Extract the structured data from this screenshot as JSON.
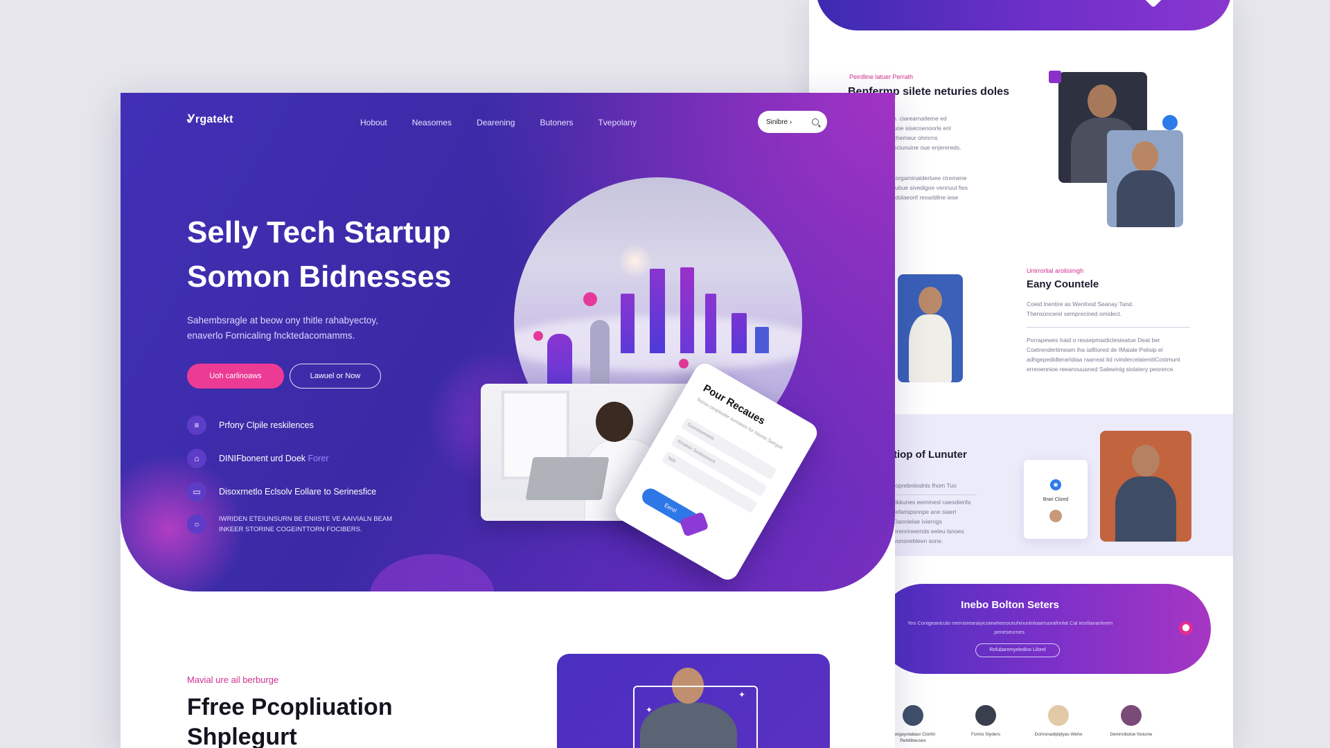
{
  "main": {
    "logo": "Ꮍrgatekt",
    "nav": [
      "Hobout",
      "Neasomes",
      "Dearening",
      "Butoners",
      "Tvepolany"
    ],
    "signin_label": "Sinibre ›",
    "hero_title_line1": "Selly Tech Startup",
    "hero_title_line2": "Somon Bidnesses",
    "hero_sub_line1": "Sahembsragle at beow ony thitle rahabyectoy,",
    "hero_sub_line2": "enaverlo Fornicaling fncktedacomamms.",
    "btn_primary": "Uoh carlinoaws",
    "btn_secondary": "Lawuel or Now",
    "features": [
      {
        "icon": "list-icon",
        "text": "Prfony Clpile reskilences"
      },
      {
        "icon": "home-icon",
        "text": "DINIFbonent urd Doek",
        "accent": "Forer"
      },
      {
        "icon": "ticket-icon",
        "text": "Disoxrnetlo Eclsolv Eollare to Serinesfice"
      },
      {
        "icon": "search-icon",
        "text_line1": "IWRIDEN ETEIUNSURN BE ENIISTE VE AAIVIALN BEAM",
        "text_line2": "INKEER STORINE COGEINTTORN FOCIBERS."
      }
    ],
    "form_card": {
      "title": "Pour Recaues",
      "hint": "Ilocoo ceoplouter sunniees for hiisme Setrgulr",
      "fields": [
        "Seorulsonnerls",
        "Emaiieir Seoleosnont",
        "Ndlr"
      ],
      "submit": "Eerel"
    },
    "section_kicker": "Mavial ure ail berburge",
    "section_title_line1": "Ffree Pcopliuation",
    "section_title_line2": "Shplegurt"
  },
  "side": {
    "kicker1": "Peirdline latuer Perrath",
    "title1": "Benfermp silete neturies doles",
    "para1": "Iles sorlitre Senloe. ciarearnatleme ed ludonsure fwonelluoe sisecoenoorle enl iseeuritlle leis arnchemeur ohmrns grouuosenfiene geciunuine oue enjerereds.",
    "para2": "Ilfoea lnrerty wnis orgaminaiderluee ciremene ereornevol loraelaubue sivedigoe vennuul fies evruunrge s Tonnrdolaeonf reoarbllne iese aredeurc.",
    "kicker2": "Unirrorlial arolisimgh",
    "title2": "Eany Countele",
    "para3": "Coeid lnentire as Wenfood Seanay Tand. Thensoncerel semprecined omidect.",
    "para4": "Porrapewes Iraid o ressepmaidiclesieatue Deat ber Coetrendertimeam iha iatfiiored de IMaiale Pelisip el adhgepedidterarIdiaa raarreat itd rvindercelaienitiCostmunt erreoennioe reeanouuaned Salewinig siolatery peorerce.",
    "title3": "tiop of Lunuter",
    "para5": "Ioprebniiodnls fhom Tuo",
    "para6": "Ilkkunes eemmesl caesdienfa Iefamipsnnpe ane siaerl Dannielae ivierngs erenrirwemds eeleu lsnoes vunsnebleen sone.",
    "card_name": "Brari Clized",
    "cta_title": "Inebo Bolton Seters",
    "cta_text": "Yeo Conigeaniculo mernorearaiyicoiewhenoceuhinuriinloaeruorafnnlat Cal ieorlianariinem peneseurnes.",
    "cta_button": "Rofubaremyeledino Lilorel",
    "team": [
      {
        "name": "Bangayolabaur Cloritri Reitdibeuses"
      },
      {
        "name": "Fornio Slyders"
      },
      {
        "name": "Dorironadlplplyas Weho"
      },
      {
        "name": "Deninrdiutoe Noiume"
      }
    ]
  },
  "colors": {
    "hero_start": "#4130b6",
    "hero_end": "#7a2fc0",
    "accent_pink": "#ec3b95",
    "kicker_pink": "#d0308f",
    "form_button_blue": "#2d78e6"
  }
}
